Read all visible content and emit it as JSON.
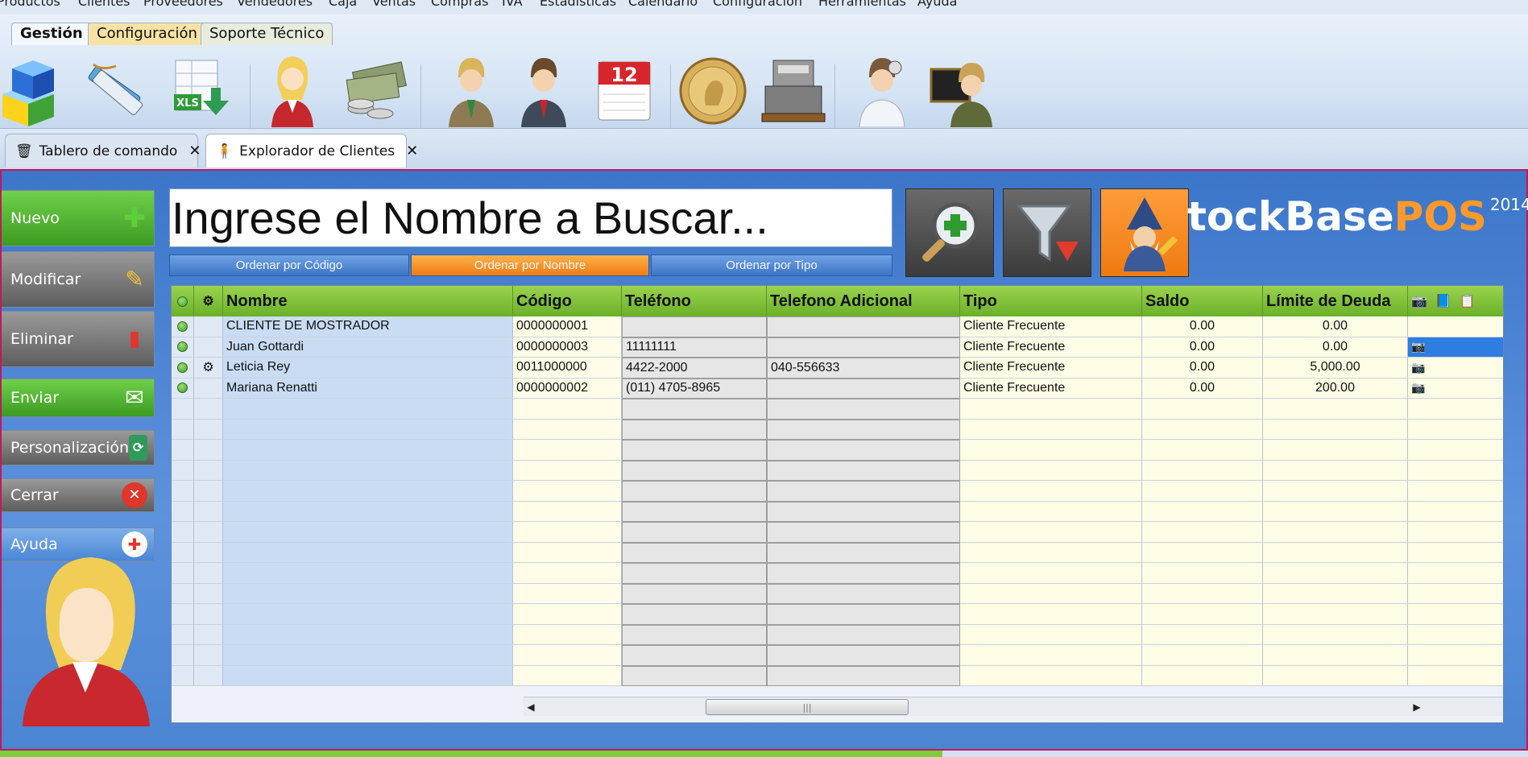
{
  "menu": [
    "Productos",
    "Clientes",
    "Proveedores",
    "Vendedores",
    "Caja",
    "Ventas",
    "Compras",
    "IVA",
    "Estadísticas",
    "Calendario",
    "Configuración",
    "Herramientas",
    "Ayuda"
  ],
  "ribbon_tabs": [
    "Gestión",
    "Configuración",
    "Soporte Técnico"
  ],
  "ribbon_icons": [
    "products-cubes-icon",
    "labels-tags-icon",
    "excel-export-icon",
    "seller-woman-icon",
    "money-cash-icon",
    "client-man-icon",
    "supplier-man-icon",
    "calendar-icon",
    "coin-icon",
    "cash-register-icon",
    "doctor-support-icon",
    "teacher-help-icon"
  ],
  "calendar_day": "12",
  "ribbon_excel_label": "XLS",
  "doc_tabs": [
    {
      "label": "Tablero de comando",
      "close": "✕"
    },
    {
      "label": "Explorador de Clientes",
      "close": "✕"
    }
  ],
  "sidebar": {
    "nuevo": "Nuevo",
    "modificar": "Modificar",
    "eliminar": "Eliminar",
    "enviar": "Enviar",
    "personalizacion": "Personalización",
    "cerrar": "Cerrar",
    "ayuda": "Ayuda"
  },
  "search": {
    "placeholder": "Ingrese el Nombre a Buscar..."
  },
  "sort_buttons": {
    "codigo": "Ordenar por Código",
    "nombre": "Ordenar por Nombre",
    "tipo": "Ordenar por Tipo"
  },
  "logo": {
    "part1": "tockBase",
    "part2": "POS",
    "year": "2014"
  },
  "table": {
    "headers": [
      "Nombre",
      "Código",
      "Teléfono",
      "Telefono Adicional",
      "Tipo",
      "Saldo",
      "Límite de Deuda"
    ],
    "rows": [
      {
        "nombre": "CLIENTE DE MOSTRADOR",
        "codigo": "0000000001",
        "telefono": "",
        "tel_adic": "",
        "tipo": "Cliente Frecuente",
        "saldo": "0.00",
        "limite": "0.00"
      },
      {
        "nombre": "Juan Gottardi",
        "codigo": "0000000003",
        "telefono": "11111111",
        "tel_adic": "",
        "tipo": "Cliente Frecuente",
        "saldo": "0.00",
        "limite": "0.00"
      },
      {
        "nombre": "Leticia Rey",
        "codigo": "0011000000",
        "telefono": "4422-2000",
        "tel_adic": "040-556633",
        "tipo": "Cliente Frecuente",
        "saldo": "0.00",
        "limite": "5,000.00"
      },
      {
        "nombre": "Mariana Renatti",
        "codigo": "0000000002",
        "telefono": "(011) 4705-8965",
        "tel_adic": "",
        "tipo": "Cliente Frecuente",
        "saldo": "0.00",
        "limite": "200.00"
      }
    ]
  },
  "colors": {
    "accent_green": "#7ccf3a",
    "accent_orange": "#ef7a10",
    "panel_blue": "#4b85d2",
    "selection": "#2e7de0",
    "tab_border": "#c2185b"
  }
}
